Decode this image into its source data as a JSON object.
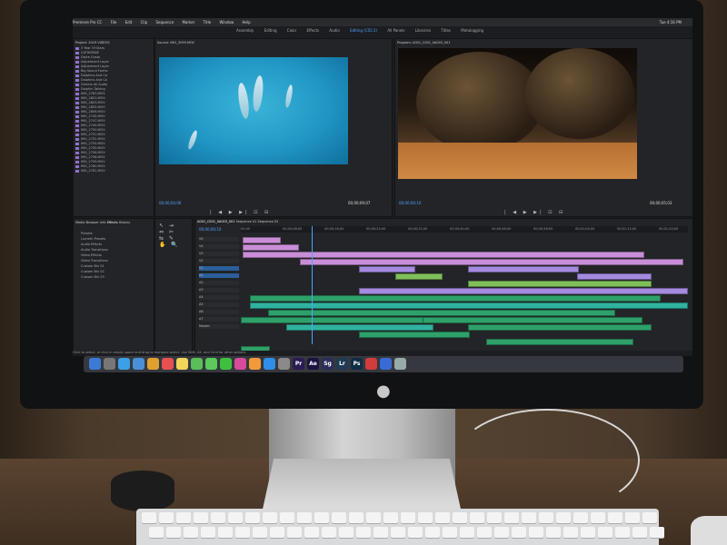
{
  "menubar": {
    "items": [
      "Premiere Pro CC",
      "File",
      "Edit",
      "Clip",
      "Sequence",
      "Marker",
      "Title",
      "Window",
      "Help"
    ],
    "clock": "Tue 4:16 PM"
  },
  "workspaces": [
    "Assembly",
    "Editing",
    "Color",
    "Effects",
    "Audio",
    "Editing (CS5.5)",
    "All Panels",
    "Libraries",
    "Titles",
    "Metalogging"
  ],
  "source": {
    "title": "Source: IMG_3299.MOV",
    "timecode_in": "00;00;04;06",
    "timecode_out": "00;00;09;07"
  },
  "program": {
    "title": "Program: A001_C001_0A003_001",
    "timecode_in": "00;00;00;10",
    "timecode_out": "00;00;05;03"
  },
  "project": {
    "title": "Project: 2019 VIDEOS",
    "items": [
      "3 Year Of Stars",
      "CATHERINE",
      "Dolce Gusto",
      "Adjustment Layer",
      "Adjustment Layer",
      "Big Sound Forms",
      "Dolphins And Co",
      "Dolphins And Co",
      "Gimme All Audio",
      "Dolphin Talking",
      "IMG_2783.MOV",
      "IMG_2801.MOV",
      "IMG_2803.MOV",
      "IMG_2805.MOV",
      "IMG_2806.MOV",
      "IMG_2745.MOV",
      "IMG_2747.MOV",
      "IMG_2749.MOV",
      "IMG_2750.MOV",
      "IMG_2751.MOV",
      "IMG_2752.MOV",
      "IMG_2754.MOV",
      "IMG_2755.MOV",
      "IMG_2756.MOV",
      "IMG_2758.MOV",
      "IMG_2759.MOV",
      "IMG_2760.MOV",
      "IMG_2761.MOV"
    ]
  },
  "effects": {
    "tabs": [
      "Media Browser",
      "Info",
      "Effects",
      "History"
    ],
    "items": [
      "Presets",
      "Lumetri Presets",
      "Audio Effects",
      "Audio Transitions",
      "Video Effects",
      "Video Transitions",
      "Custom Bin 01",
      "Custom Bin 02",
      "Custom Bin 03"
    ]
  },
  "timeline": {
    "tabs": [
      "A001_C001_0A003_001",
      "Sequence 01",
      "Sequence 02"
    ],
    "timecode": "00;00;00;10",
    "ruler": [
      "00;00",
      "00;00;08;00",
      "00;00;16;00",
      "00;00;24;00",
      "00;00;32;00",
      "00;00;40;00",
      "00;00;48;00",
      "00;00;56;00",
      "00;01;04;00",
      "00;01;12;00",
      "00;01;20;00"
    ],
    "tracks": [
      "V5",
      "V4",
      "V3",
      "V2",
      "V1",
      "A1",
      "A2",
      "A3",
      "A4",
      "A5",
      "A6",
      "A7",
      "Master"
    ]
  },
  "status_text": "Click to select, or click in empty space and drag to marquee select. Use Shift, Alt, and Cmd for other options.",
  "dock_icons": [
    "finder-icon",
    "launchpad-icon",
    "safari-icon",
    "mail-icon",
    "photos-icon",
    "calendar-icon",
    "notes-icon",
    "maps-icon",
    "messages-icon",
    "facetime-icon",
    "itunes-icon",
    "ibooks-icon",
    "app-store-icon",
    "preferences-icon",
    "Pr",
    "Ae",
    "Sg",
    "Lr",
    "Ps",
    "creative-cloud-icon",
    "downloads-icon",
    "trash-icon"
  ],
  "colors": {
    "clip_video": "#c98ed8",
    "clip_purple": "#a58ae0",
    "clip_green": "#7fbf5a",
    "clip_audio": "#2ea06a",
    "timecode": "#4fa3ff"
  }
}
